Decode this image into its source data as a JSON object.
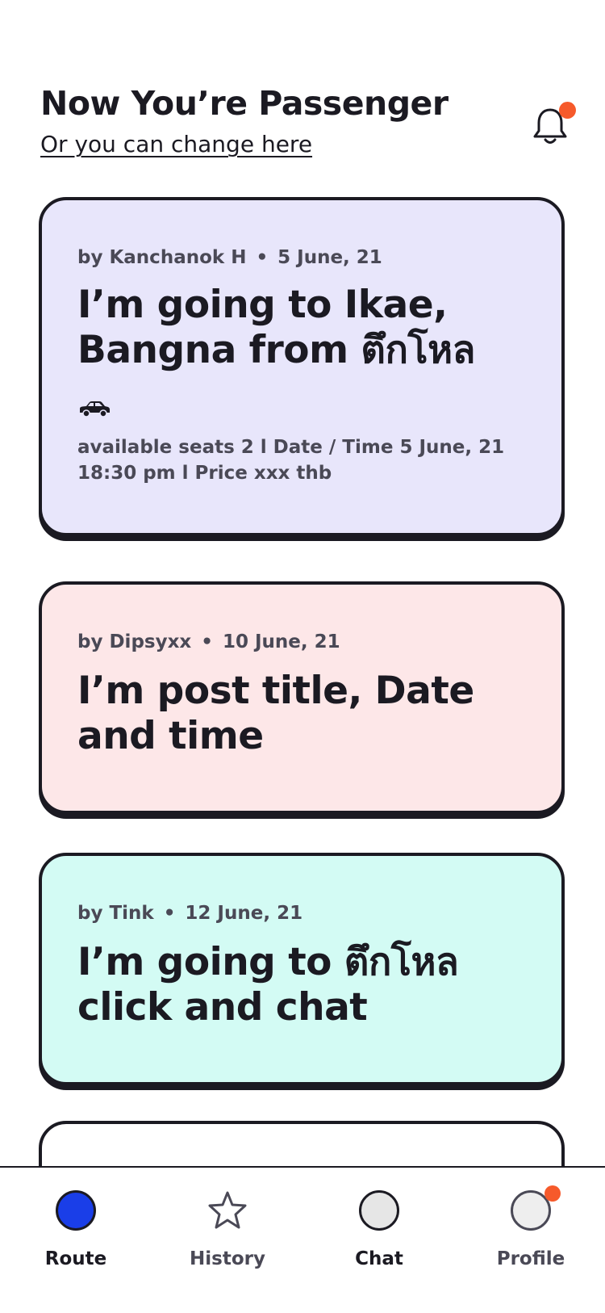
{
  "header": {
    "title": "Now You’re Passenger",
    "subtitle": "Or you can change here",
    "notification_icon": "bell-icon",
    "notification_dot_color": "#f65a2b"
  },
  "posts": [
    {
      "author": "by Kanchanok H",
      "separator": "•",
      "date": "5 June, 21",
      "title": "I’m going to Ikae, Bangna from ตึกโหล",
      "icon": "car-icon",
      "details": "available seats 2 l Date / Time 5 June, 21 18:30 pm l Price xxx thb",
      "bg_color": "#e8e6fb"
    },
    {
      "author": "by Dipsyxx",
      "separator": "•",
      "date": "10 June, 21",
      "title": "I’m post title, Date and time",
      "bg_color": "#fde7e8"
    },
    {
      "author": "by Tink",
      "separator": "•",
      "date": "12 June, 21",
      "title": "I’m going to ตึกโหล click and chat",
      "bg_color": "#d3fbf4"
    }
  ],
  "nav": {
    "items": [
      {
        "label": "Route",
        "icon": "route-circle-icon",
        "color": "#1a3ee8",
        "active": true
      },
      {
        "label": "History",
        "icon": "star-icon",
        "color": "#4a4956"
      },
      {
        "label": "Chat",
        "icon": "chat-circle-icon",
        "color": "#e6e6e6"
      },
      {
        "label": "Profile",
        "icon": "profile-circle-icon",
        "color": "#eeeeee",
        "badge_color": "#f65a2b"
      }
    ],
    "label_active_color": "#1b1a22",
    "label_inactive_color": "#4a4956"
  }
}
